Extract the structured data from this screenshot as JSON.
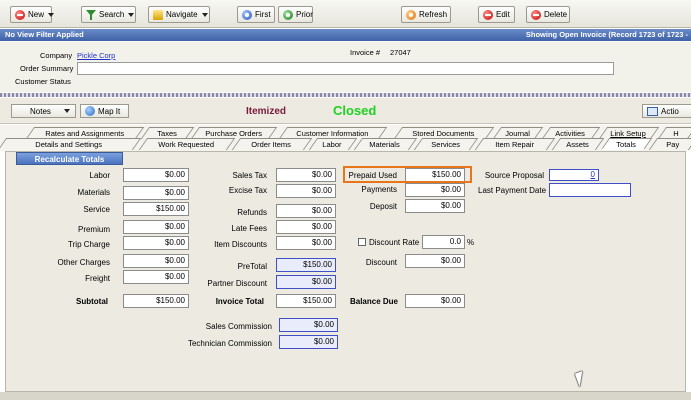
{
  "toolbar": {
    "new": "New",
    "search": "Search",
    "navigate": "Navigate",
    "first": "First",
    "prior": "Prior",
    "refresh": "Refresh",
    "edit": "Edit",
    "delete": "Delete"
  },
  "filter_bar": {
    "left": "No View Filter Applied",
    "right": "Showing Open Invoice  (Record 1723 of 1723 -"
  },
  "header": {
    "company_label": "Company",
    "company_value": "Pickle Corp",
    "invoice_label": "Invoice #",
    "invoice_value": "27047",
    "order_summary_label": "Order Summary",
    "order_summary_value": "",
    "customer_status_label": "Customer Status"
  },
  "bar2": {
    "notes": "Notes",
    "map_it": "Map It",
    "itemized": "Itemized",
    "closed": "Closed",
    "action": "Actio"
  },
  "tabs_top": [
    "Rates and Assignments",
    "Taxes",
    "Purchase Orders",
    "Customer Information",
    "Stored Documents",
    "Journal",
    "Activities",
    "Link Setup",
    "H"
  ],
  "tabs_bottom": [
    "Details and Settings",
    "Work Requested",
    "Order Items",
    "Labor",
    "Materials",
    "Services",
    "Item Repair",
    "Assets",
    "Totals",
    "Pay"
  ],
  "recalc": "Recalculate Totals",
  "col1": {
    "labor_label": "Labor",
    "labor": "$0.00",
    "materials_label": "Materials",
    "materials": "$0.00",
    "service_label": "Service",
    "service": "$150.00",
    "premium_label": "Premium",
    "premium": "$0.00",
    "trip_label": "Trip Charge",
    "trip": "$0.00",
    "other_label": "Other Charges",
    "other": "$0.00",
    "freight_label": "Freight",
    "freight": "$0.00",
    "subtotal_label": "Subtotal",
    "subtotal": "$150.00"
  },
  "col2": {
    "sales_tax_label": "Sales Tax",
    "sales_tax": "$0.00",
    "excise_label": "Excise Tax",
    "excise": "$0.00",
    "refunds_label": "Refunds",
    "refunds": "$0.00",
    "late_label": "Late Fees",
    "late": "$0.00",
    "discounts_label": "Item Discounts",
    "discounts": "$0.00",
    "pretotal_label": "PreTotal",
    "pretotal": "$150.00",
    "partner_label": "Partner Discount",
    "partner": "$0.00",
    "invoice_total_label": "Invoice Total",
    "invoice_total": "$150.00",
    "sales_comm_label": "Sales Commission",
    "sales_comm": "$0.00",
    "tech_comm_label": "Technician Commission",
    "tech_comm": "$0.00"
  },
  "col3": {
    "prepaid_label": "Prepaid Used",
    "prepaid": "$150.00",
    "payments_label": "Payments",
    "payments": "$0.00",
    "deposit_label": "Deposit",
    "deposit": "$0.00",
    "discount_rate_label": "Discount Rate",
    "discount_rate": "0.0",
    "pct": "%",
    "discount_label": "Discount",
    "discount": "$0.00",
    "balance_label": "Balance Due",
    "balance": "$0.00"
  },
  "col4": {
    "source_label": "Source Proposal",
    "source": "0",
    "last_payment_label": "Last Payment Date",
    "last_payment": ""
  }
}
